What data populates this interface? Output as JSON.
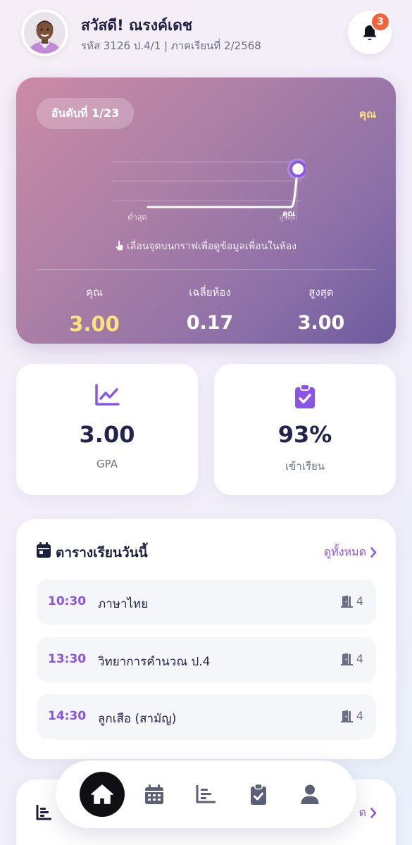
{
  "header": {
    "greeting": "สวัสดี! ณรงค์เดช",
    "info": "รหัส 3126 ป.4/1 | ภาคเรียนที่ 2/2568",
    "notification_count": "3"
  },
  "rank_card": {
    "rank_label": "อันดับที่ 1/23",
    "you_label": "คุณ",
    "chart_low_label": "ต่ำสุด",
    "chart_high_label": "สูงสุด",
    "chart_you_marker": "คุณ",
    "tip": "เลื่อนจุดบนกราฟเพื่อดูข้อมูลเพื่อนในห้อง",
    "stats": [
      {
        "label": "คุณ",
        "value": "3.00"
      },
      {
        "label": "เฉลี่ยห้อง",
        "value": "0.17"
      },
      {
        "label": "สูงสุด",
        "value": "3.00"
      }
    ]
  },
  "chart_data": {
    "type": "line",
    "description_x": "class ranking from lowest to highest",
    "x_labels": [
      "ต่ำสุด",
      "สูงสุด"
    ],
    "highlight_label": "คุณ",
    "values": [
      0,
      0,
      0,
      0,
      0,
      0,
      0,
      0,
      0,
      0,
      0,
      0,
      0,
      0,
      0,
      0,
      0,
      0,
      0,
      0,
      0,
      0,
      3.0
    ],
    "highlight_value": 3.0,
    "ylim": [
      0,
      3.0
    ]
  },
  "cards": {
    "gpa": {
      "value": "3.00",
      "label": "GPA",
      "icon": "chart-line-icon"
    },
    "attendance": {
      "value": "93%",
      "label": "เข้าเรียน",
      "icon": "clipboard-check-icon"
    }
  },
  "schedule": {
    "title": "ตารางเรียนวันนี้",
    "see_all": "ดูทั้งหมด",
    "rows": [
      {
        "time": "10:30",
        "subject": "ภาษาไทย",
        "room": "4"
      },
      {
        "time": "13:30",
        "subject": "วิทยาการคำนวณ ป.4",
        "room": "4"
      },
      {
        "time": "14:30",
        "subject": "ลูกเสือ (สามัญ)",
        "room": "4"
      }
    ]
  },
  "grades_card": {
    "see_all_partial": "ด"
  },
  "nav": {
    "items": [
      "home-icon",
      "calendar-icon",
      "chart-icon",
      "clipboard-icon",
      "user-icon"
    ]
  },
  "colors": {
    "accent": "#8a55e6",
    "gold": "#ffe27a",
    "badge": "#f4623a"
  }
}
